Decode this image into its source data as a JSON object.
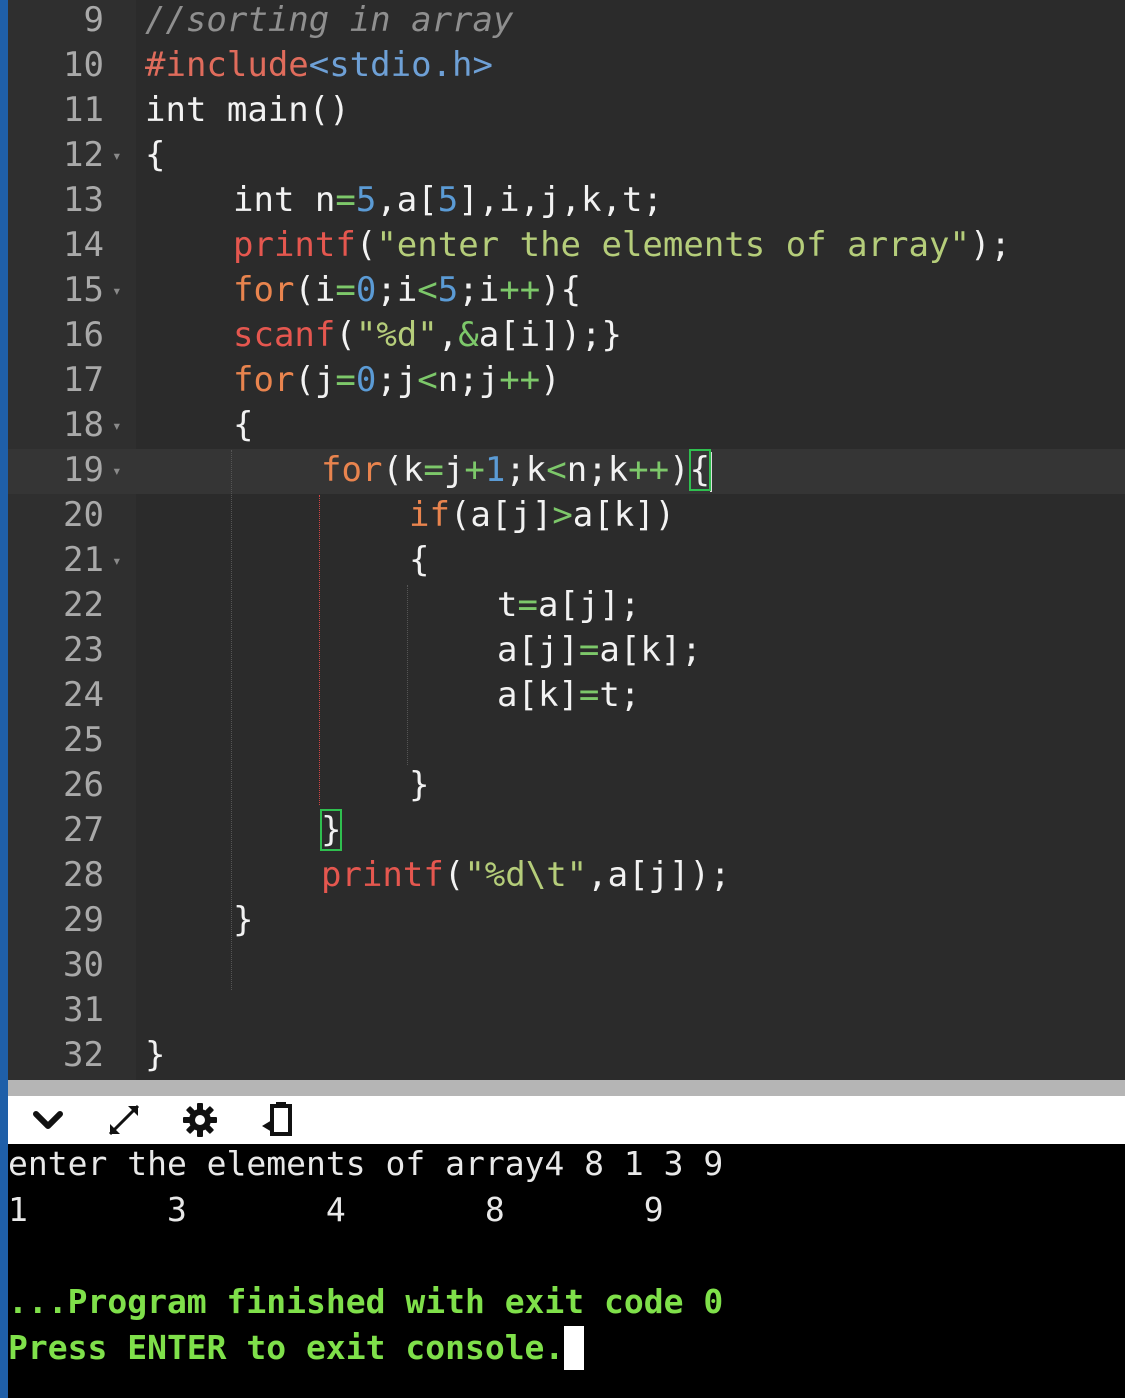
{
  "editor": {
    "active_line": "19",
    "lines": [
      {
        "n": "9",
        "fold": false
      },
      {
        "n": "10",
        "fold": false
      },
      {
        "n": "11",
        "fold": false
      },
      {
        "n": "12",
        "fold": true
      },
      {
        "n": "13",
        "fold": false
      },
      {
        "n": "14",
        "fold": false
      },
      {
        "n": "15",
        "fold": true
      },
      {
        "n": "16",
        "fold": false
      },
      {
        "n": "17",
        "fold": false
      },
      {
        "n": "18",
        "fold": true
      },
      {
        "n": "19",
        "fold": true
      },
      {
        "n": "20",
        "fold": false
      },
      {
        "n": "21",
        "fold": true
      },
      {
        "n": "22",
        "fold": false
      },
      {
        "n": "23",
        "fold": false
      },
      {
        "n": "24",
        "fold": false
      },
      {
        "n": "25",
        "fold": false
      },
      {
        "n": "26",
        "fold": false
      },
      {
        "n": "27",
        "fold": false
      },
      {
        "n": "28",
        "fold": false
      },
      {
        "n": "29",
        "fold": false
      },
      {
        "n": "30",
        "fold": false
      },
      {
        "n": "31",
        "fold": false
      },
      {
        "n": "32",
        "fold": false
      }
    ],
    "code": {
      "l9": "//sorting in array",
      "l10_pp": "#include",
      "l10_inc": "<stdio.h>",
      "l11": "int main()",
      "l12": "{",
      "l13_a": "int n",
      "l13_eq": "=",
      "l13_5": "5",
      "l13_b": ",a[",
      "l13_5b": "5",
      "l13_c": "],i,j,k,t;",
      "l14_fn": "printf",
      "l14_p": "(",
      "l14_str": "\"enter the elements of array\"",
      "l14_end": ");",
      "l15_kw": "for",
      "l15_a": "(i",
      "l15_eq": "=",
      "l15_0": "0",
      "l15_b": ";i",
      "l15_lt": "<",
      "l15_5": "5",
      "l15_c": ";i",
      "l15_pp": "++",
      "l15_d": "){",
      "l16_fn": "scanf",
      "l16_p": "(",
      "l16_str": "\"%d\"",
      "l16_comma": ",",
      "l16_amp": "&",
      "l16_end": "a[i]);}",
      "l17_kw": "for",
      "l17_a": "(j",
      "l17_eq": "=",
      "l17_0": "0",
      "l17_b": ";j",
      "l17_lt": "<",
      "l17_c": "n;j",
      "l17_pp": "++",
      "l17_d": ")",
      "l18": "{",
      "l19_kw": "for",
      "l19_a": "(k",
      "l19_eq": "=",
      "l19_b": "j",
      "l19_plus": "+",
      "l19_1": "1",
      "l19_c": ";k",
      "l19_lt": "<",
      "l19_d": "n;k",
      "l19_pp": "++",
      "l19_e": ")",
      "l19_br": "{",
      "l20_kw": "if",
      "l20_a": "(a[j]",
      "l20_gt": ">",
      "l20_b": "a[k])",
      "l21": "{",
      "l22_a": "t",
      "l22_eq": "=",
      "l22_b": "a[j];",
      "l23_a": "a[j]",
      "l23_eq": "=",
      "l23_b": "a[k];",
      "l24_a": "a[k]",
      "l24_eq": "=",
      "l24_b": "t;",
      "l26": "}",
      "l27": "}",
      "l28_fn": "printf",
      "l28_p": "(",
      "l28_str": "\"%d\\t\"",
      "l28_end": ",a[j]);",
      "l29": "}",
      "l32": "}"
    }
  },
  "toolbar": {
    "icons": [
      "chevron-down-icon",
      "expand-icon",
      "gear-icon",
      "share-icon"
    ]
  },
  "console": {
    "line1": "enter the elements of array4 8 1 3 9",
    "line2": "1       3       4       8       9",
    "line3": "...Program finished with exit code 0",
    "line4": "Press ENTER to exit console."
  },
  "colors": {
    "accent_strip": "#1f5fa8",
    "keyword": "#e9844e",
    "function": "#e5574f",
    "string": "#b5cd7a",
    "operator": "#7dc86a",
    "number": "#5b9bd5",
    "console_green": "#7fe04a"
  }
}
